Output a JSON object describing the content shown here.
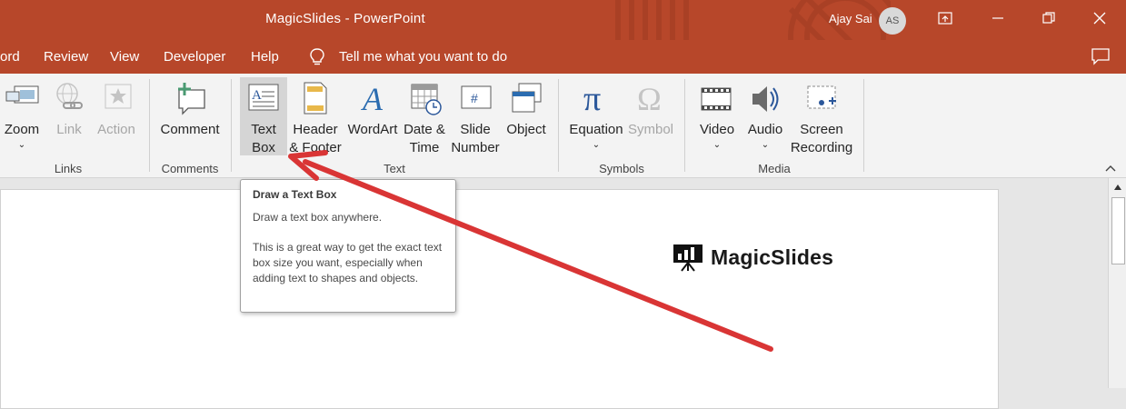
{
  "window": {
    "title": "MagicSlides  -  PowerPoint",
    "user_name": "Ajay Sai",
    "user_initials": "AS"
  },
  "menu": {
    "items": [
      "ord",
      "Review",
      "View",
      "Developer",
      "Help"
    ],
    "tell_me": "Tell me what you want to do"
  },
  "ribbon": {
    "links": {
      "label": "Links",
      "buttons": [
        {
          "label": "Zoom",
          "icon": "zoom-icon",
          "dropdown": true,
          "enabled": true
        },
        {
          "label": "Link",
          "icon": "link-icon",
          "enabled": false
        },
        {
          "label": "Action",
          "icon": "action-icon",
          "enabled": false
        }
      ]
    },
    "comments": {
      "label": "Comments",
      "buttons": [
        {
          "label": "Comment",
          "icon": "new-comment-icon"
        }
      ]
    },
    "text": {
      "label": "Text",
      "buttons": [
        {
          "line1": "Text",
          "line2": "Box",
          "icon": "text-box-icon",
          "active": true
        },
        {
          "line1": "Header",
          "line2": "& Footer",
          "icon": "header-footer-icon"
        },
        {
          "line1": "WordArt",
          "line2": "",
          "icon": "wordart-icon"
        },
        {
          "line1": "Date &",
          "line2": "Time",
          "icon": "date-time-icon"
        },
        {
          "line1": "Slide",
          "line2": "Number",
          "icon": "slide-number-icon"
        },
        {
          "line1": "Object",
          "line2": "",
          "icon": "object-icon"
        }
      ]
    },
    "symbols": {
      "label": "Symbols",
      "buttons": [
        {
          "label": "Equation",
          "icon": "pi-icon",
          "dropdown": true,
          "enabled": true
        },
        {
          "label": "Symbol",
          "icon": "omega-icon",
          "enabled": false
        }
      ]
    },
    "media": {
      "label": "Media",
      "buttons": [
        {
          "line1": "Video",
          "line2": "",
          "icon": "video-icon",
          "dropdown": true
        },
        {
          "line1": "Audio",
          "line2": "",
          "icon": "audio-icon",
          "dropdown": true
        },
        {
          "line1": "Screen",
          "line2": "Recording",
          "icon": "screen-recording-icon"
        }
      ]
    }
  },
  "tooltip": {
    "title": "Draw a Text Box",
    "line": "Draw a text box anywhere.",
    "body": "This is a great way to get the exact text box size you want, especially when adding text to shapes and objects."
  },
  "slide": {
    "logo_text": "MagicSlides"
  },
  "colors": {
    "accent": "#b7472a",
    "annotation_arrow": "#d93535"
  }
}
